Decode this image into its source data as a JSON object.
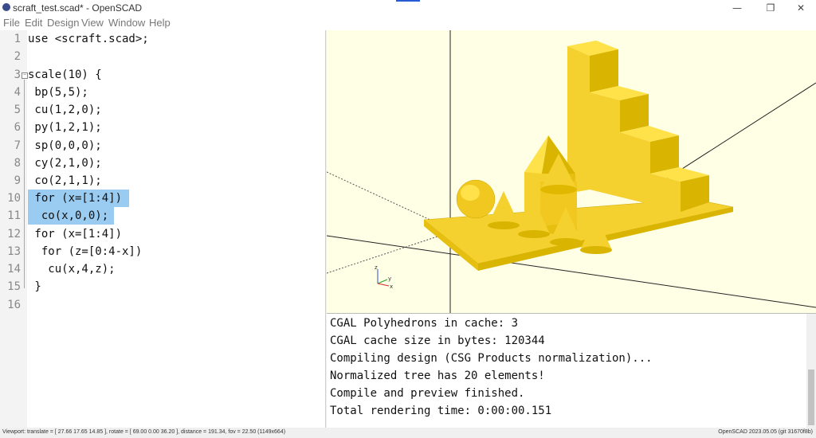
{
  "window": {
    "title": "scraft_test.scad* - OpenSCAD",
    "minimize": "—",
    "restore": "❐",
    "close": "✕"
  },
  "menu": [
    "File",
    "Edit",
    "Design",
    "View",
    "Window",
    "Help"
  ],
  "editor": {
    "lines": [
      {
        "n": "1",
        "text": "use <scraft.scad>;"
      },
      {
        "n": "2",
        "text": ""
      },
      {
        "n": "3",
        "text": "scale(10) {"
      },
      {
        "n": "4",
        "text": " bp(5,5);"
      },
      {
        "n": "5",
        "text": " cu(1,2,0);"
      },
      {
        "n": "6",
        "text": " py(1,2,1);"
      },
      {
        "n": "7",
        "text": " sp(0,0,0);"
      },
      {
        "n": "8",
        "text": " cy(2,1,0);"
      },
      {
        "n": "9",
        "text": " co(2,1,1);"
      },
      {
        "n": "10",
        "text": " for (x=[1:4])"
      },
      {
        "n": "11",
        "text": "  co(x,0,0);"
      },
      {
        "n": "12",
        "text": " for (x=[1:4])"
      },
      {
        "n": "13",
        "text": "  for (z=[0:4-x])"
      },
      {
        "n": "14",
        "text": "   cu(x,4,z);"
      },
      {
        "n": "15",
        "text": " }"
      },
      {
        "n": "16",
        "text": ""
      }
    ]
  },
  "viewport": {
    "axis_labels": {
      "z": "z",
      "y": "y",
      "x": "x"
    },
    "colors": {
      "background": "#ffffe5",
      "model": "#f5d130",
      "model_dark": "#d9b400",
      "model_light": "#ffe24a"
    }
  },
  "console": {
    "lines": [
      "CGAL Polyhedrons in cache: 3",
      "CGAL cache size in bytes: 120344",
      "Compiling design (CSG Products normalization)...",
      "Normalized tree has 20 elements!",
      "Compile and preview finished.",
      "Total rendering time: 0:00:00.151"
    ]
  },
  "statusbar": {
    "viewport": "Viewport: translate = [ 27.66 17.65 14.85 ], rotate = [ 69.00 0.00 36.20 ], distance = 191.34, fov = 22.50 (1149x664)",
    "version": "OpenSCAD 2023.05.05 (git 31670f8b)"
  }
}
